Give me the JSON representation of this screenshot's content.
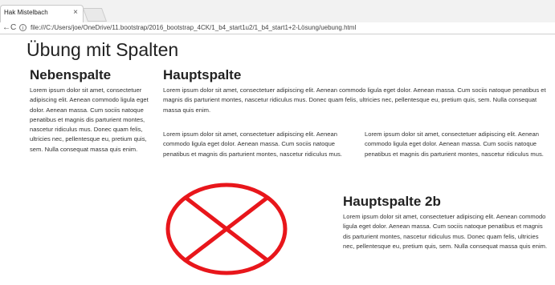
{
  "browser": {
    "tab_title": "Hak Mistelbach",
    "tab_close": "×",
    "nav_back": "←",
    "nav_reload": "C",
    "info": "i",
    "url": "file:///C:/Users/joe/OneDrive/11.bootstrap/2016_bootstrap_4CK/1_b4_start1u2/1_b4_start1+2-Lösung/uebung.html"
  },
  "page": {
    "title": "Übung mit Spalten",
    "sidebar": {
      "heading": "Nebenspalte",
      "text": "Lorem ipsum dolor sit amet, consectetuer adipiscing elit. Aenean commodo ligula eget dolor. Aenean massa. Cum sociis natoque penatibus et magnis dis parturient montes, nascetur ridiculus mus. Donec quam felis, ultricies nec, pellentesque eu, pretium quis, sem. Nulla consequat massa quis enim."
    },
    "main": {
      "heading": "Hauptspalte",
      "text": "Lorem ipsum dolor sit amet, consectetuer adipiscing elit. Aenean commodo ligula eget dolor. Aenean massa. Cum sociis natoque penatibus et magnis dis parturient montes, nascetur ridiculus mus. Donec quam felis, ultricies nec, pellentesque eu, pretium quis, sem. Nulla consequat massa quis enim.",
      "col_left": "Lorem ipsum dolor sit amet, consectetuer adipiscing elit. Aenean commodo ligula eget dolor. Aenean massa. Cum sociis natoque penatibus et magnis dis parturient montes, nascetur ridiculus mus.",
      "col_right": "Lorem ipsum dolor sit amet, consectetuer adipiscing elit. Aenean commodo ligula eget dolor. Aenean massa. Cum sociis natoque penatibus et magnis dis parturient montes, nascetur ridiculus mus."
    },
    "sub": {
      "heading": "Hauptspalte 2b",
      "text": "Lorem ipsum dolor sit amet, consectetuer adipiscing elit. Aenean commodo ligula eget dolor. Aenean massa. Cum sociis natoque penatibus et magnis dis parturient montes, nascetur ridiculus mus. Donec quam felis, ultricies nec, pellentesque eu, pretium quis, sem. Nulla consequat massa quis enim."
    },
    "placeholder": {
      "icon": "crossed-circle-icon",
      "color": "#e8161b"
    }
  }
}
